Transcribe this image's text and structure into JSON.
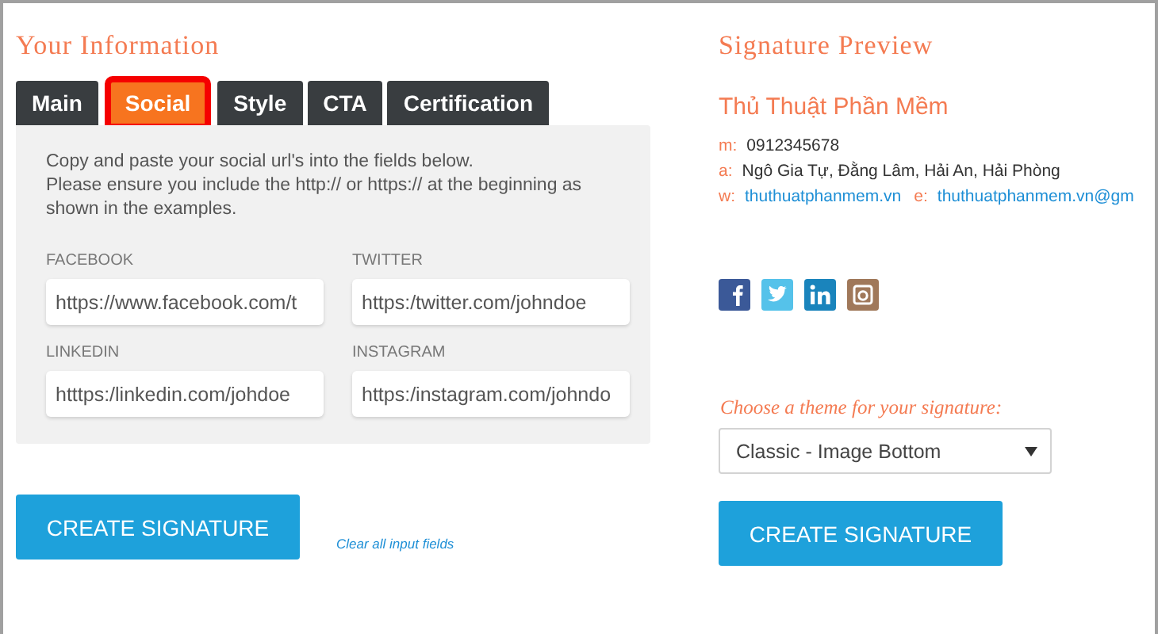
{
  "left": {
    "title": "Your Information",
    "tabs": [
      {
        "label": "Main",
        "selected": false,
        "highlighted": false
      },
      {
        "label": "Social",
        "selected": true,
        "highlighted": true
      },
      {
        "label": "Style",
        "selected": false,
        "highlighted": false
      },
      {
        "label": "CTA",
        "selected": false,
        "highlighted": false
      },
      {
        "label": "Certification",
        "selected": false,
        "highlighted": false
      }
    ],
    "instructions": [
      "Copy and paste your social url's into the fields below.",
      "Please ensure you include the http:// or https:// at the beginning as shown in the examples."
    ],
    "fields": [
      {
        "label": "FACEBOOK",
        "value": "https://www.facebook.com/t"
      },
      {
        "label": "TWITTER",
        "value": "https:/twitter.com/johndoe"
      },
      {
        "label": "LINKEDIN",
        "value": "htttps:/linkedin.com/johdoe"
      },
      {
        "label": "INSTAGRAM",
        "value": "https:/instagram.com/johndo"
      }
    ],
    "create_button": "CREATE SIGNATURE",
    "clear_link": "Clear all input fields"
  },
  "right": {
    "title": "Signature Preview",
    "name": "Thủ Thuật Phần Mềm",
    "lines": [
      [
        {
          "key": "m:",
          "value": "0912345678",
          "kind": "text"
        }
      ],
      [
        {
          "key": "a:",
          "value": "Ngô Gia Tự, Đằng Lâm, Hải An, Hải Phòng",
          "kind": "text"
        }
      ],
      [
        {
          "key": "w:",
          "value": "thuthuatphanmem.vn",
          "kind": "link"
        },
        {
          "key": "e:",
          "value": "thuthuatphanmem.vn@gm",
          "kind": "link"
        }
      ]
    ],
    "social_icons": [
      {
        "kind": "facebook",
        "color": "#3b5998"
      },
      {
        "kind": "twitter",
        "color": "#55c2ea"
      },
      {
        "kind": "linkedin",
        "color": "#1a84bc"
      },
      {
        "kind": "instagram",
        "color": "#a0785a"
      }
    ],
    "theme_label": "Choose a theme for your signature:",
    "theme_select": "Classic - Image Bottom",
    "create_button": "CREATE SIGNATURE"
  }
}
